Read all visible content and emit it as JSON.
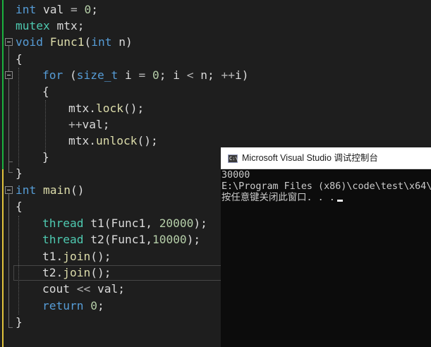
{
  "editor": {
    "code": {
      "l1": {
        "type": "int",
        "var": " val ",
        "op": "=",
        "num": " 0",
        "end": ";"
      },
      "l2": {
        "type": "mutex",
        "var": " mtx;"
      },
      "l3": {
        "kw": "void",
        "fn": " Func1",
        "p1": "(",
        "type": "int",
        "var": " n",
        "p2": ")"
      },
      "l4": {
        "text": "{"
      },
      "l5": {
        "kw": "for",
        "p1": " (",
        "type": "size_t",
        "v1": " i ",
        "op": "=",
        "num": " 0",
        "v2": "; i ",
        "lt": "<",
        "v3": " n; ",
        "inc": "++",
        "v4": "i",
        ")": ")"
      },
      "l6": {
        "text": "{"
      },
      "l7": {
        "v1": "mtx.",
        "fn": "lock",
        "v2": "();"
      },
      "l8": {
        "inc": "++",
        "v": "val;"
      },
      "l9": {
        "v1": "mtx.",
        "fn": "unlock",
        "v2": "();"
      },
      "l10": {
        "text": "}"
      },
      "l11": {
        "text": "}"
      },
      "l12": {
        "type": "int",
        "fn": " main",
        "p": "()"
      },
      "l13": {
        "text": "{"
      },
      "l14": {
        "type": "thread",
        "v1": " t1(Func1, ",
        "num": "20000",
        "v2": ");"
      },
      "l15": {
        "type": "thread",
        "v1": " t2(Func1,",
        "num": "10000",
        "v2": ");"
      },
      "l16": {
        "v1": "t1.",
        "fn": "join",
        "v2": "();"
      },
      "l17": {
        "v1": "t2.",
        "fn": "join",
        "v2": "();"
      },
      "l18": {
        "v1": "cout ",
        "op": "<<",
        "v2": " val;"
      },
      "l19": {
        "kw": "return",
        "num": " 0",
        "v2": ";"
      },
      "l20": {
        "text": "}"
      }
    }
  },
  "console": {
    "title": "Microsoft Visual Studio 调试控制台",
    "icon_label": "C:\\",
    "output": [
      "30000",
      "E:\\Program Files (x86)\\code\\test\\x64\\",
      "按任意键关闭此窗口. . ."
    ]
  },
  "colors": {
    "keyword": "#569cd6",
    "type": "#4ec9b0",
    "function": "#dcdcaa",
    "number": "#b5cea8",
    "background": "#1e1e1e",
    "console_bg": "#0c0c0c"
  }
}
